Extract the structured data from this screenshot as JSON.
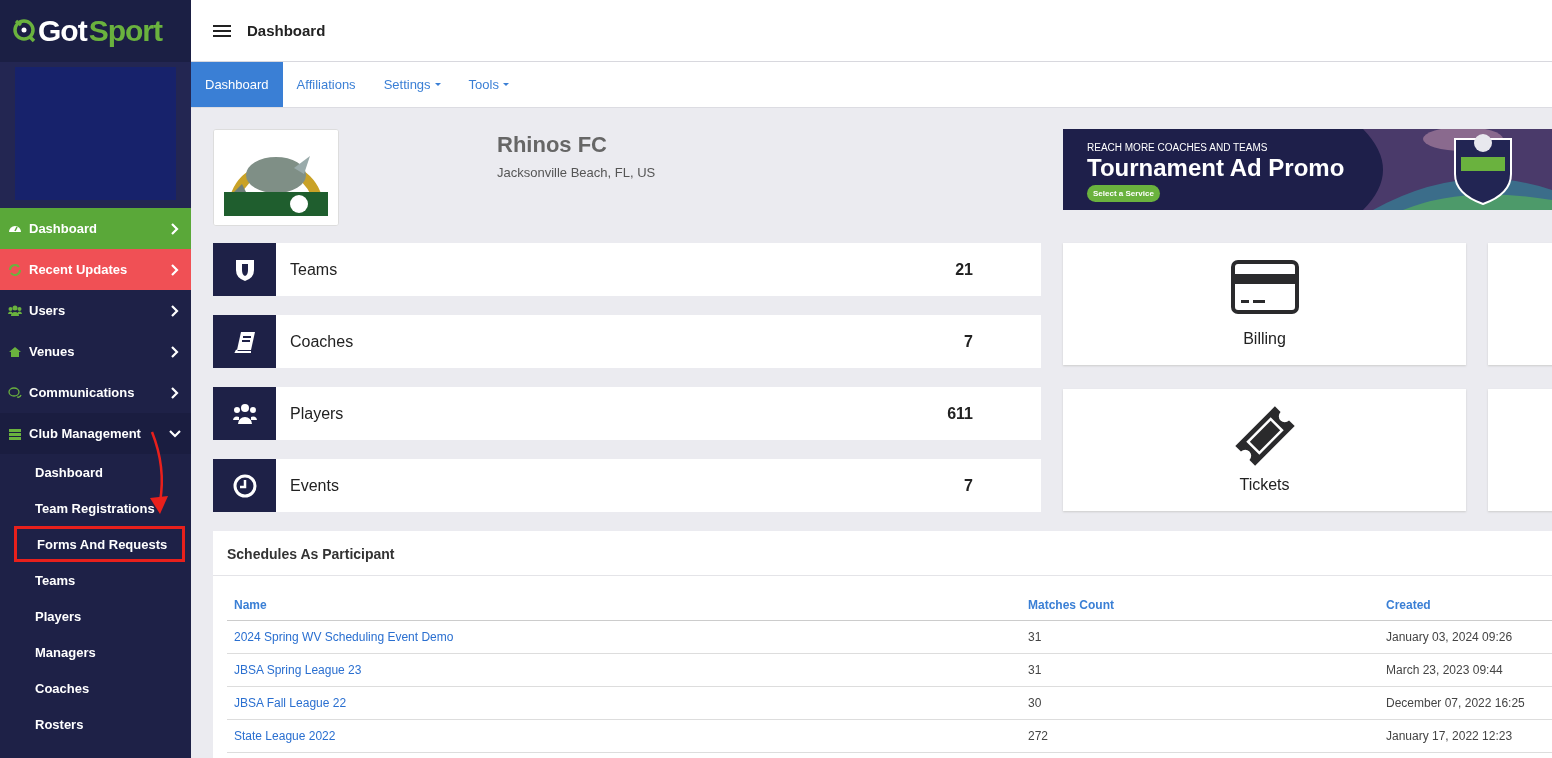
{
  "brand": {
    "logo_left": "Got",
    "logo_right": "Sport"
  },
  "sidebar": {
    "items": [
      {
        "label": "Dashboard",
        "kind": "green",
        "expanded": false
      },
      {
        "label": "Recent Updates",
        "kind": "red",
        "expanded": false
      },
      {
        "label": "Users",
        "kind": "plain",
        "expanded": false
      },
      {
        "label": "Venues",
        "kind": "plain",
        "expanded": false
      },
      {
        "label": "Communications",
        "kind": "plain",
        "expanded": false
      },
      {
        "label": "Club Management",
        "kind": "dark",
        "expanded": true,
        "children": [
          {
            "label": "Dashboard",
            "highlighted": false
          },
          {
            "label": "Team Registrations",
            "highlighted": false
          },
          {
            "label": "Forms And Requests",
            "highlighted": true
          },
          {
            "label": "Teams",
            "highlighted": false
          },
          {
            "label": "Players",
            "highlighted": false
          },
          {
            "label": "Managers",
            "highlighted": false
          },
          {
            "label": "Coaches",
            "highlighted": false
          },
          {
            "label": "Rosters",
            "highlighted": false
          }
        ]
      }
    ]
  },
  "header": {
    "title": "Dashboard"
  },
  "tabs": [
    {
      "label": "Dashboard",
      "selected": true,
      "dropdown": false
    },
    {
      "label": "Affiliations",
      "selected": false,
      "dropdown": false
    },
    {
      "label": "Settings",
      "selected": false,
      "dropdown": true
    },
    {
      "label": "Tools",
      "selected": false,
      "dropdown": true
    }
  ],
  "club": {
    "name": "Rhinos FC",
    "location": "Jacksonville Beach, FL, US"
  },
  "ad": {
    "kicker": "REACH MORE COACHES AND TEAMS",
    "title": "Tournament Ad Promo",
    "button": "Select a Service"
  },
  "stats": [
    {
      "label": "Teams",
      "count": "21"
    },
    {
      "label": "Coaches",
      "count": "7"
    },
    {
      "label": "Players",
      "count": "611"
    },
    {
      "label": "Events",
      "count": "7"
    }
  ],
  "tiles": [
    {
      "label": "Billing"
    },
    {
      "label": "Tickets"
    }
  ],
  "schedules": {
    "title": "Schedules As Participant",
    "columns": [
      "Name",
      "Matches Count",
      "Created"
    ],
    "rows": [
      [
        "2024 Spring WV Scheduling Event Demo",
        "31",
        "January 03, 2024 09:26"
      ],
      [
        "JBSA Spring League 23",
        "31",
        "March 23, 2023 09:44"
      ],
      [
        "JBSA Fall League 22",
        "30",
        "December 07, 2022 16:25"
      ],
      [
        "State League 2022",
        "272",
        "January 17, 2022 12:23"
      ]
    ]
  }
}
